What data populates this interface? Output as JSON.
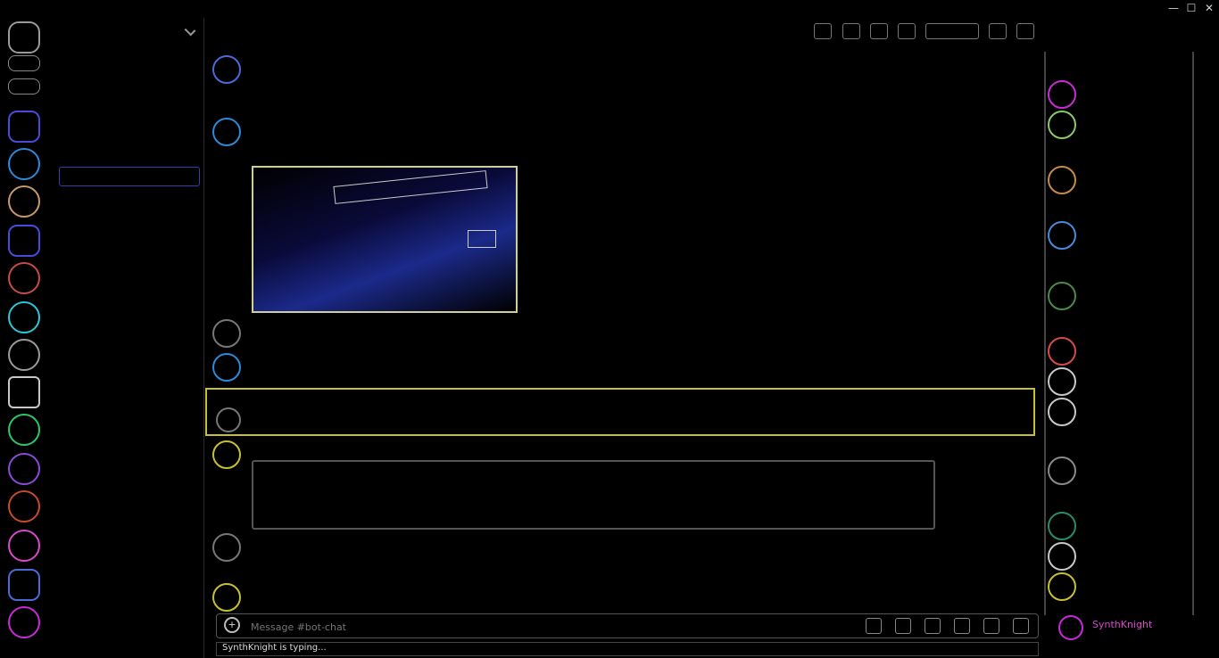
{
  "window": {
    "title": "",
    "controls": [
      "—",
      "☐",
      "✕"
    ]
  },
  "composer": {
    "placeholder": "Message #bot-chat",
    "typing": "SynthKnight is typing..."
  },
  "member_list": {
    "footer_name": "SynthKnight"
  },
  "colors": {
    "highlight": "#c8c030",
    "active_channel": "#3a3aa8",
    "code": "#d07a30"
  },
  "icons": [
    "threads-icon",
    "notification-bell-icon",
    "pin-icon",
    "members-icon",
    "search-icon",
    "inbox-icon",
    "help-icon",
    "add-attachment-icon",
    "gift-icon",
    "gif-icon",
    "sticker-icon",
    "emoji-icon"
  ]
}
